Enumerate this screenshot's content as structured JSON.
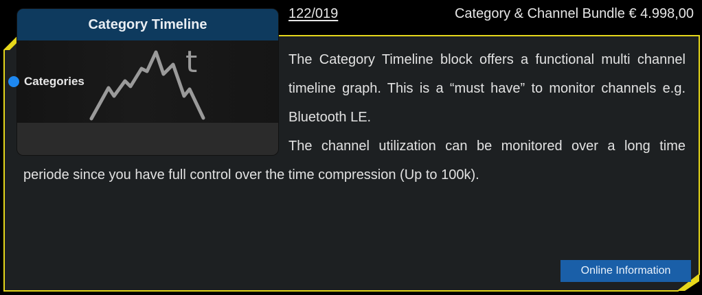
{
  "header": {
    "article_number": "122/019",
    "product_price": "Category & Channel Bundle € 4.998,00"
  },
  "block": {
    "title": "Category Timeline",
    "port_label": "Categories",
    "graphic_letter": "t",
    "icon": "timeline-graph-icon"
  },
  "description": {
    "paragraph_1": "The Category Timeline block offers a functional multi channel timeline graph. This is a “must have” to monitor channels e.g. Bluetooth LE.",
    "paragraph_2": "The channel utilization can be monitored over a long time periode since you have full control over the time compression (Up to 100k)."
  },
  "actions": {
    "info_button_label": "Online Information"
  },
  "colors": {
    "frame_border": "#e6d71b",
    "panel_background": "#1d2022",
    "block_header": "#0e3a5e",
    "port_dot": "#1e88f0",
    "button_background": "#1a5fa8"
  }
}
